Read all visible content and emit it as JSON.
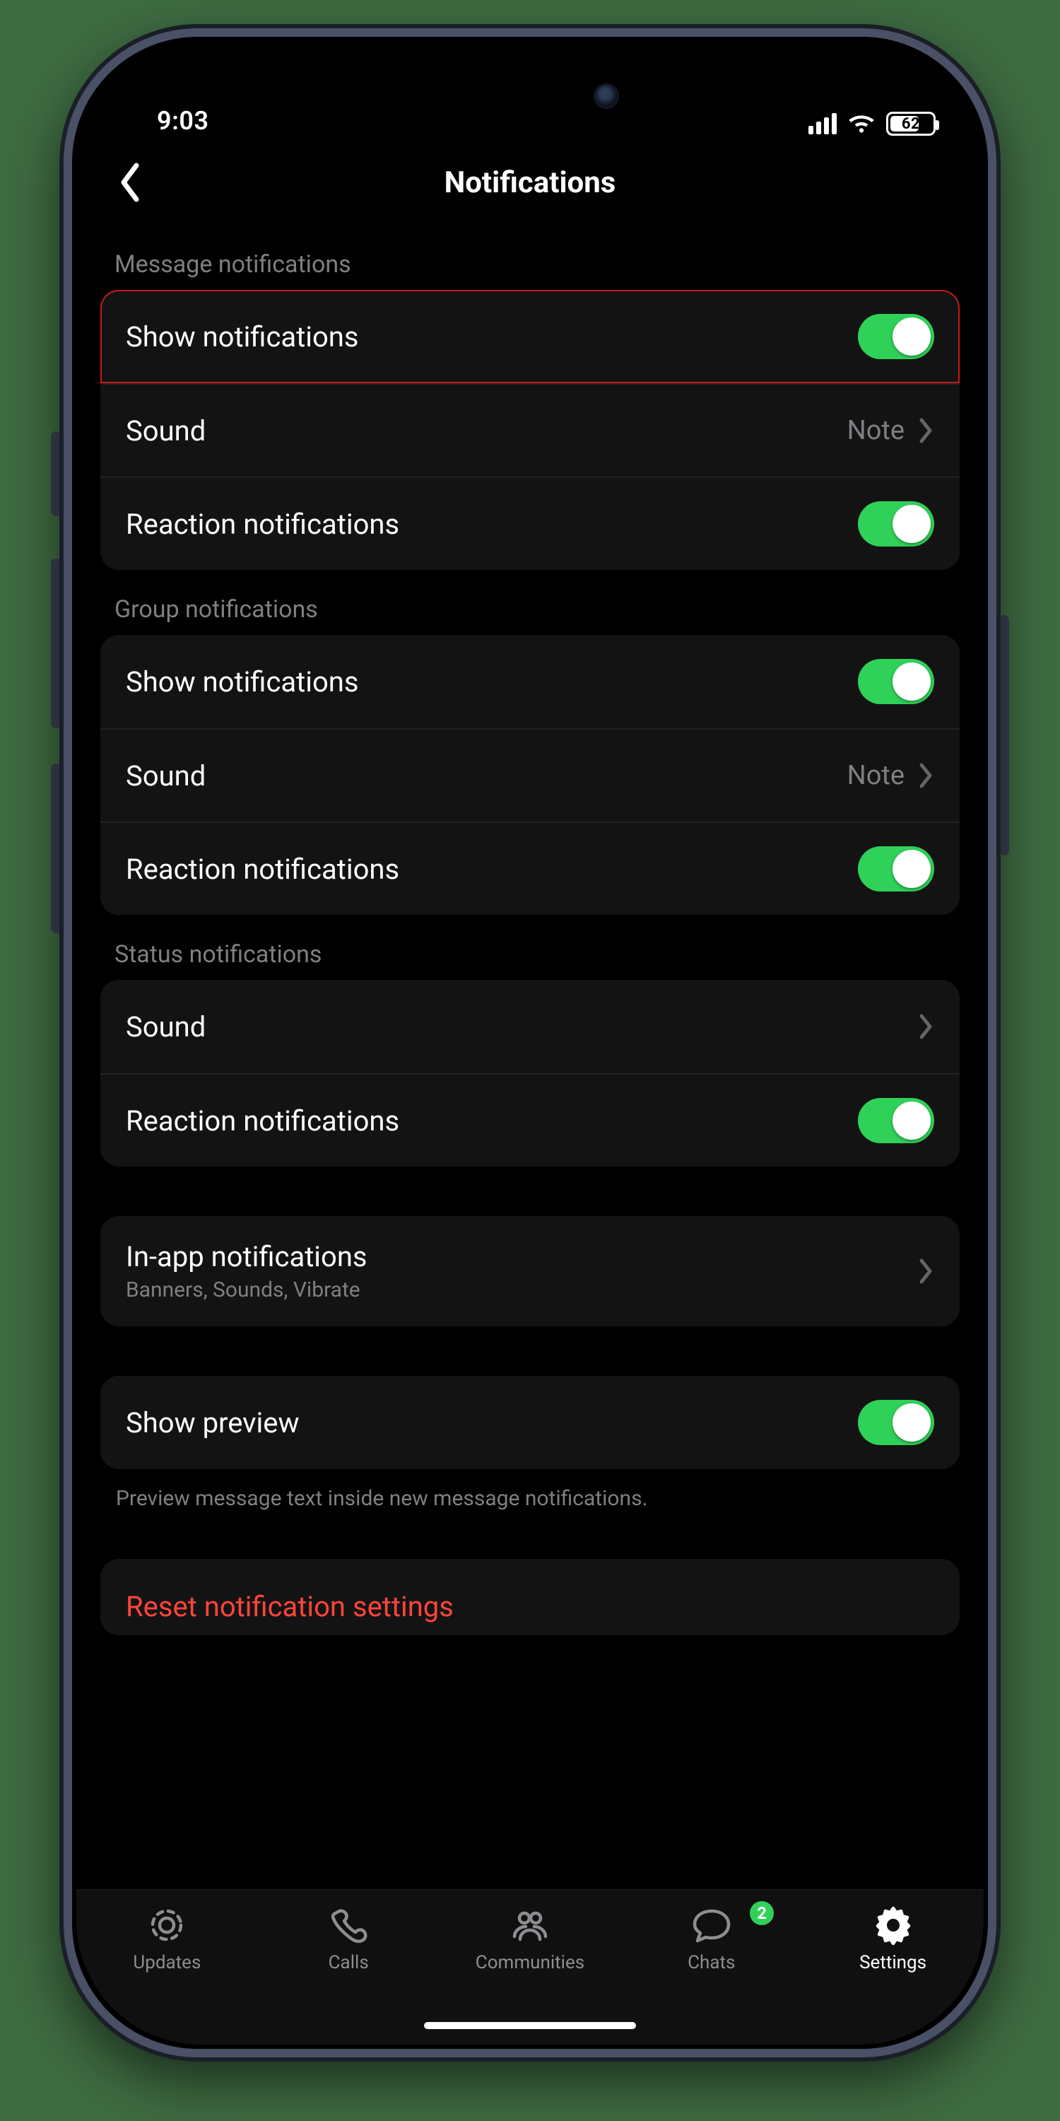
{
  "status": {
    "time": "9:03",
    "battery": "62"
  },
  "header": {
    "title": "Notifications"
  },
  "sections": {
    "message": {
      "title": "Message notifications",
      "show": "Show notifications",
      "sound_label": "Sound",
      "sound_value": "Note",
      "reaction": "Reaction notifications"
    },
    "group": {
      "title": "Group notifications",
      "show": "Show notifications",
      "sound_label": "Sound",
      "sound_value": "Note",
      "reaction": "Reaction notifications"
    },
    "status": {
      "title": "Status notifications",
      "sound_label": "Sound",
      "reaction": "Reaction notifications"
    },
    "inapp": {
      "label": "In-app notifications",
      "sub": "Banners, Sounds, Vibrate"
    },
    "preview": {
      "label": "Show preview",
      "note": "Preview message text inside new message notifications."
    },
    "reset": {
      "label": "Reset notification settings"
    }
  },
  "tabs": {
    "updates": "Updates",
    "calls": "Calls",
    "communities": "Communities",
    "chats": "Chats",
    "chats_badge": "2",
    "settings": "Settings"
  }
}
